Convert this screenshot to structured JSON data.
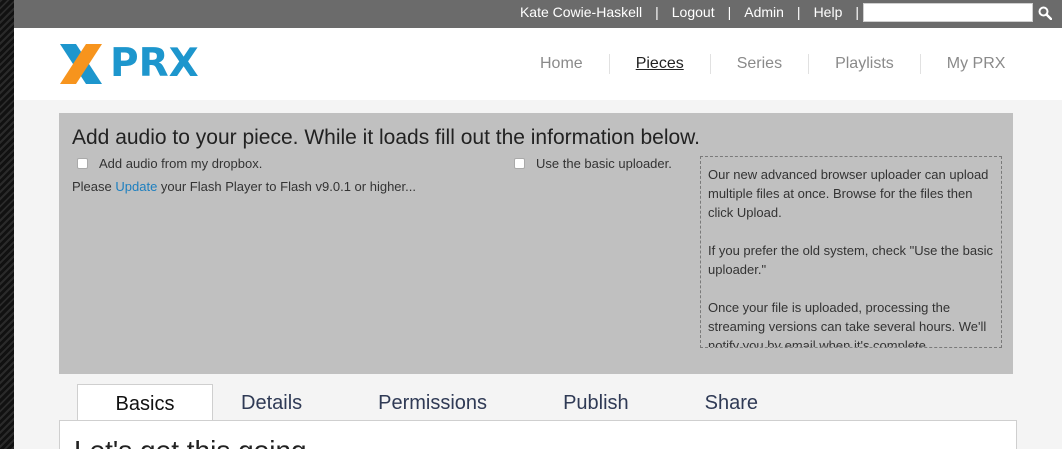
{
  "topbar": {
    "links": [
      "Kate Cowie-Haskell",
      "Logout",
      "Admin",
      "Help"
    ],
    "search": {
      "value": "",
      "placeholder": ""
    }
  },
  "header": {
    "logo_text": "PRX",
    "nav": [
      {
        "label": "Home",
        "active": false
      },
      {
        "label": "Pieces",
        "active": true
      },
      {
        "label": "Series",
        "active": false
      },
      {
        "label": "Playlists",
        "active": false
      },
      {
        "label": "My PRX",
        "active": false
      }
    ]
  },
  "upload": {
    "title": "Add audio to your piece. While it loads fill out the information below.",
    "dropbox_label": "Add audio from my dropbox.",
    "basic_label": "Use the basic uploader.",
    "flash_before": "Please ",
    "flash_link": "Update",
    "flash_after": " your Flash Player to Flash v9.0.1 or higher...",
    "help": [
      "Our new advanced browser uploader can upload multiple files at once. Browse for the files then click Upload.",
      "If you prefer the old system, check \"Use the basic uploader.\"",
      "Once your file is uploaded, processing the streaming versions can take several hours. We'll notify you by email when it's complete."
    ]
  },
  "tabs": [
    {
      "label": "Basics",
      "active": true
    },
    {
      "label": "Details",
      "active": false
    },
    {
      "label": "Permissions",
      "active": false
    },
    {
      "label": "Publish",
      "active": false
    },
    {
      "label": "Share",
      "active": false
    }
  ],
  "content": {
    "heading": "Let's get this going"
  },
  "colors": {
    "accent": "#1d96cd",
    "logo_orange": "#f7941d",
    "topbar": "#6b6b6b",
    "panel": "#c0c0c0"
  }
}
